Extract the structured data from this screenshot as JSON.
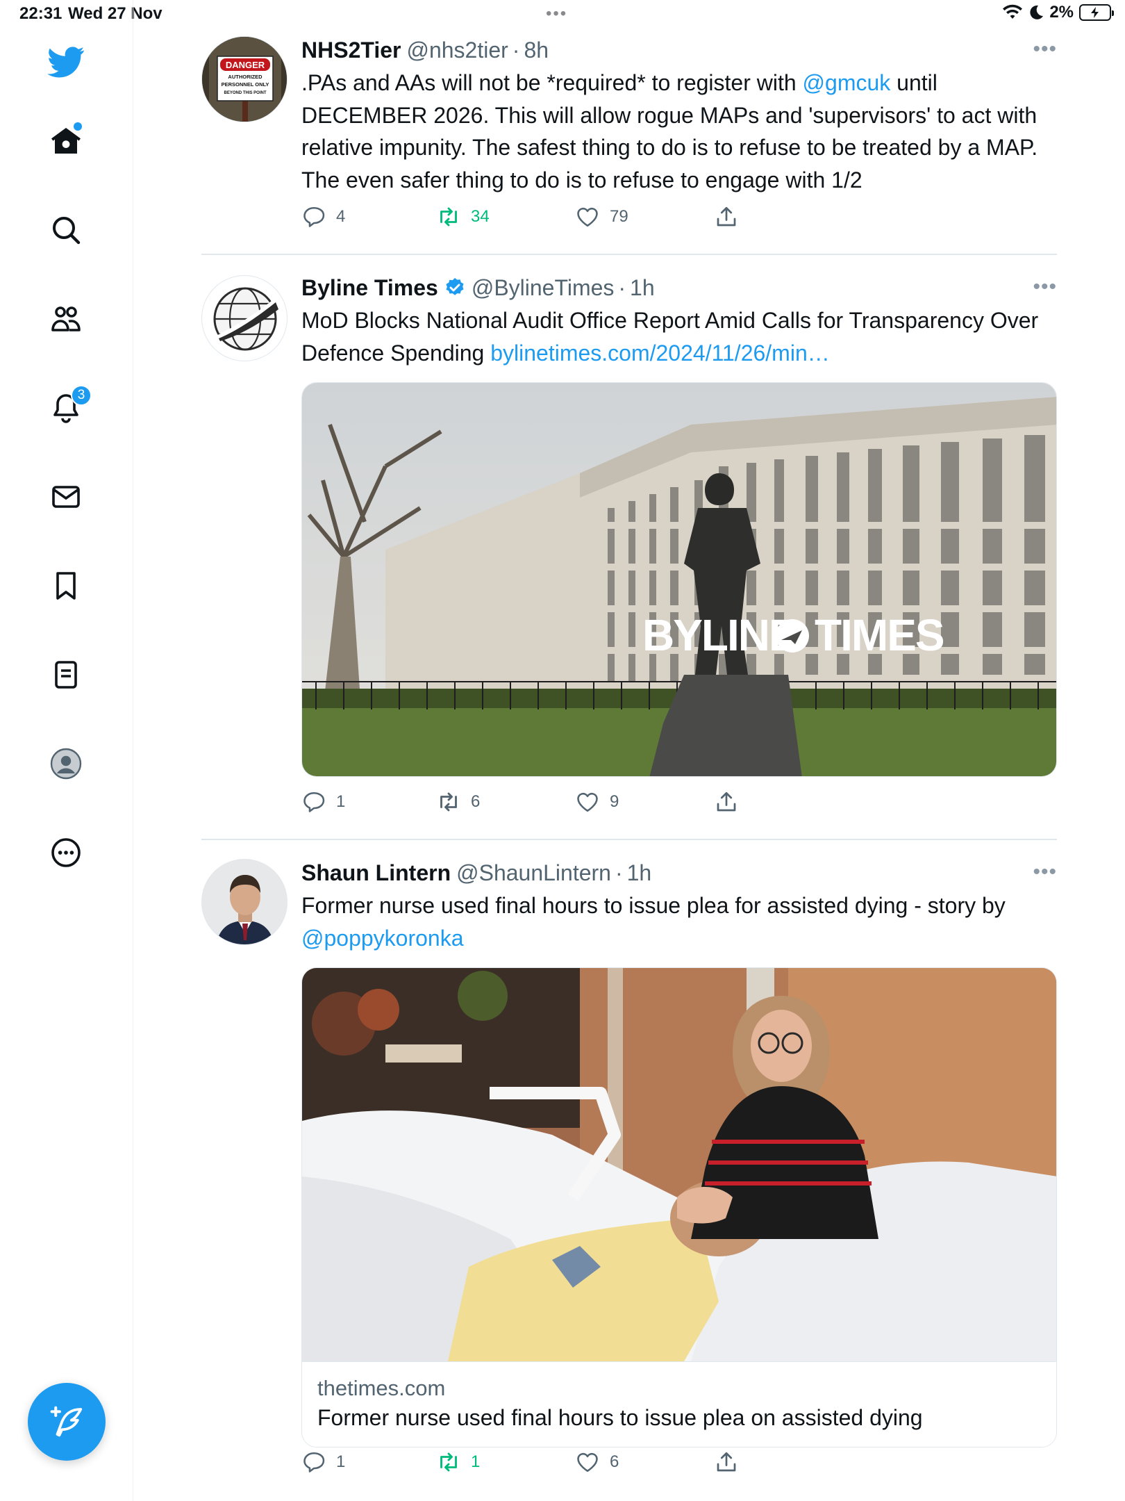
{
  "status_bar": {
    "time": "22:31",
    "date": "Wed 27 Nov",
    "battery": "2%"
  },
  "sidebar": {
    "items": [
      {
        "name": "home",
        "icon": "home-icon",
        "has_dot": true
      },
      {
        "name": "explore",
        "icon": "search-icon"
      },
      {
        "name": "communities",
        "icon": "communities-icon"
      },
      {
        "name": "notifications",
        "icon": "bell-icon",
        "badge": "3"
      },
      {
        "name": "messages",
        "icon": "mail-icon"
      },
      {
        "name": "bookmarks",
        "icon": "bookmark-icon"
      },
      {
        "name": "lists",
        "icon": "list-icon"
      },
      {
        "name": "profile",
        "icon": "profile-icon"
      },
      {
        "name": "more",
        "icon": "more-circle-icon"
      }
    ],
    "compose_icon": "compose-feather-icon"
  },
  "tweets": [
    {
      "name": "NHS2Tier",
      "handle": "@nhs2tier",
      "time": "8h",
      "text_before": ".PAs and AAs will not be *required* to register with ",
      "mention": "@gmcuk",
      "text_after": " until DECEMBER 2026. This will allow rogue MAPs and 'supervisors' to act with relative impunity. The safest thing to do is to refuse to be treated by a MAP. The even safer thing to do is to refuse to engage with 1/2",
      "avatar_sign": {
        "line1": "DANGER",
        "line2": "AUTHORIZED",
        "line3": "PERSONNEL ONLY",
        "line4": "BEYOND THIS POINT"
      },
      "replies": "4",
      "retweets": "34",
      "likes": "79",
      "retweeted": true
    },
    {
      "name": "Byline Times",
      "handle": "@BylineTimes",
      "time": "1h",
      "verified": true,
      "text": "MoD Blocks National Audit Office Report Amid Calls for Transparency Over Defence Spending ",
      "link": "bylinetimes.com/2024/11/26/min…",
      "image_watermark_left": "BYLINE",
      "image_watermark_right": "TIMES",
      "replies": "1",
      "retweets": "6",
      "likes": "9"
    },
    {
      "name": "Shaun Lintern",
      "handle": "@ShaunLintern",
      "time": "1h",
      "text": "Former nurse used final hours to issue plea for assisted dying - story by ",
      "mention": "@poppykoronka",
      "card_domain": "thetimes.com",
      "card_title": "Former nurse used final hours to issue plea on assisted dying",
      "replies": "1",
      "retweets": "1",
      "likes": "6",
      "retweeted": true
    }
  ],
  "colors": {
    "accent": "#1d9bf0",
    "retweet_green": "#00ba7c",
    "secondary_text": "#536471"
  }
}
